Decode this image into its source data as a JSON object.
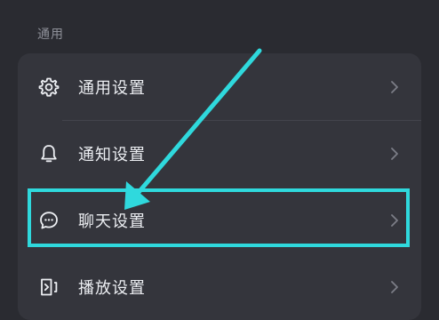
{
  "section": {
    "title": "通用"
  },
  "items": [
    {
      "label": "通用设置",
      "icon": "gear-icon"
    },
    {
      "label": "通知设置",
      "icon": "bell-icon"
    },
    {
      "label": "聊天设置",
      "icon": "chat-bubble-icon"
    },
    {
      "label": "播放设置",
      "icon": "play-settings-icon"
    }
  ],
  "colors": {
    "background": "#2a2b31",
    "card": "#34353c",
    "text": "#eceef2",
    "muted": "#8e9099",
    "annotation": "#2fd9dd"
  }
}
